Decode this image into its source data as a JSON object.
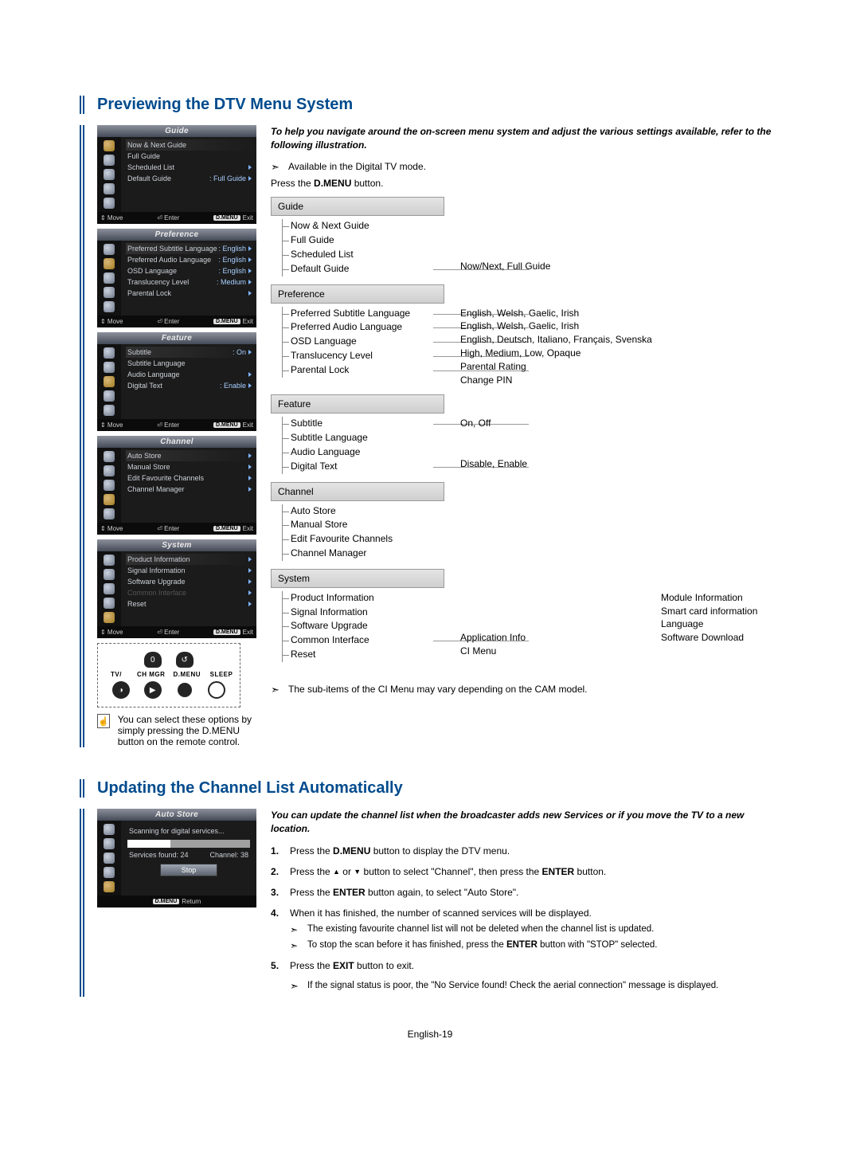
{
  "page_footer": "English-19",
  "section1": {
    "title": "Previewing the DTV Menu System",
    "intro": "To help you navigate around the on-screen menu system and adjust the various settings available, refer to the following illustration.",
    "note_digital": "Available in the Digital TV mode.",
    "press_line_a": "Press the ",
    "press_line_b": "D.MENU",
    "press_line_c": " button.",
    "ci_note": "The sub-items of the CI Menu may vary depending on the CAM model.",
    "tip": "You can select these options by simply pressing the D.MENU button on the remote control.",
    "remote_labels": [
      "TV/",
      "CH MGR",
      "D.MENU",
      "SLEEP"
    ],
    "foot": {
      "move": "Move",
      "enter": "Enter",
      "dmenu": "D.MENU",
      "exit": "Exit",
      "return": "Return"
    },
    "panels": [
      {
        "title": "Guide",
        "rows": [
          {
            "l": "Now & Next Guide",
            "r": "",
            "arrow": false,
            "hl": true
          },
          {
            "l": "Full Guide",
            "r": "",
            "arrow": false
          },
          {
            "l": "Scheduled List",
            "r": "",
            "arrow": true
          },
          {
            "l": "Default Guide",
            "r": ": Full Guide",
            "arrow": true
          }
        ]
      },
      {
        "title": "Preference",
        "rows": [
          {
            "l": "Preferred Subtitle Language",
            "r": ": English",
            "arrow": true,
            "hl": true
          },
          {
            "l": "Preferred Audio Language",
            "r": ": English",
            "arrow": true
          },
          {
            "l": "OSD Language",
            "r": ": English",
            "arrow": true
          },
          {
            "l": "Translucency Level",
            "r": ": Medium",
            "arrow": true
          },
          {
            "l": "Parental Lock",
            "r": "",
            "arrow": true
          }
        ]
      },
      {
        "title": "Feature",
        "rows": [
          {
            "l": "Subtitle",
            "r": ": On",
            "arrow": true,
            "hl": true
          },
          {
            "l": "Subtitle Language",
            "r": "",
            "arrow": false
          },
          {
            "l": "Audio Language",
            "r": "",
            "arrow": true
          },
          {
            "l": "Digital Text",
            "r": ": Enable",
            "arrow": true
          }
        ]
      },
      {
        "title": "Channel",
        "rows": [
          {
            "l": "Auto Store",
            "r": "",
            "arrow": true,
            "hl": true
          },
          {
            "l": "Manual Store",
            "r": "",
            "arrow": true
          },
          {
            "l": "Edit Favourite Channels",
            "r": "",
            "arrow": true
          },
          {
            "l": "Channel Manager",
            "r": "",
            "arrow": true
          }
        ]
      },
      {
        "title": "System",
        "rows": [
          {
            "l": "Product Information",
            "r": "",
            "arrow": true,
            "hl": true
          },
          {
            "l": "Signal Information",
            "r": "",
            "arrow": true
          },
          {
            "l": "Software Upgrade",
            "r": "",
            "arrow": true
          },
          {
            "l": "Common Interface",
            "r": "",
            "arrow": true,
            "dim": true
          },
          {
            "l": "Reset",
            "r": "",
            "arrow": true
          }
        ]
      }
    ],
    "tree": [
      {
        "head": "Guide",
        "items": [
          {
            "l": "Now & Next Guide",
            "link": false
          },
          {
            "l": "Full Guide",
            "link": false
          },
          {
            "l": "Scheduled List",
            "link": false
          },
          {
            "l": "Default Guide",
            "link": true
          }
        ],
        "vals": [
          "",
          "",
          "",
          "Now/Next, Full Guide"
        ]
      },
      {
        "head": "Preference",
        "items": [
          {
            "l": "Preferred Subtitle Language",
            "link": true
          },
          {
            "l": "Preferred Audio Language",
            "link": true
          },
          {
            "l": "OSD Language",
            "link": true
          },
          {
            "l": "Translucency Level",
            "link": true
          },
          {
            "l": "Parental Lock",
            "link": true
          }
        ],
        "vals": [
          "English, Welsh, Gaelic, Irish",
          "English, Welsh, Gaelic, Irish",
          "English, Deutsch, Italiano, Français, Svenska",
          "High, Medium, Low, Opaque",
          "Parental Rating<br>Change PIN"
        ]
      },
      {
        "head": "Feature",
        "items": [
          {
            "l": "Subtitle",
            "link": true
          },
          {
            "l": "Subtitle Language",
            "link": false
          },
          {
            "l": "Audio Language",
            "link": false
          },
          {
            "l": "Digital Text",
            "link": true
          }
        ],
        "vals": [
          "On, Off",
          "",
          "",
          "Disable, Enable"
        ]
      },
      {
        "head": "Channel",
        "items": [
          {
            "l": "Auto Store",
            "link": false
          },
          {
            "l": "Manual Store",
            "link": false
          },
          {
            "l": "Edit Favourite Channels",
            "link": false
          },
          {
            "l": "Channel Manager",
            "link": false
          }
        ],
        "vals": []
      },
      {
        "head": "System",
        "items": [
          {
            "l": "Product Information",
            "link": false
          },
          {
            "l": "Signal Information",
            "link": false
          },
          {
            "l": "Software Upgrade",
            "link": false
          },
          {
            "l": "Common Interface",
            "link": true
          },
          {
            "l": "Reset",
            "link": false
          }
        ],
        "vals": [
          "",
          "",
          "",
          "Application Info<br>CI Menu",
          ""
        ],
        "extra": [
          "Module Information",
          "Smart card information",
          "Language",
          "Software Download"
        ]
      }
    ]
  },
  "section2": {
    "title": "Updating the Channel List Automatically",
    "intro": "You can update the channel list when the broadcaster adds new Services or if you move the TV to a new location.",
    "panel": {
      "title": "Auto Store",
      "scanning": "Scanning for digital services...",
      "percent": "35%",
      "services_label": "Services found: 24",
      "channel_label": "Channel: 38",
      "stop": "Stop"
    },
    "steps": [
      {
        "pre": "Press the ",
        "b": "D.MENU",
        "post": " button to display the DTV menu."
      },
      {
        "pre": "Press the ",
        "mid": " or ",
        "post": " button to select \"Channel\", then press the ",
        "b": "ENTER",
        "tail": " button."
      },
      {
        "pre": "Press the ",
        "b": "ENTER",
        "post": " button again, to select \"Auto Store\"."
      },
      {
        "pre": "When it has finished, the number of scanned services will be displayed.",
        "subs": [
          "The existing favourite channel list will not be deleted when the channel list is updated.",
          "To stop the scan before it has finished, press the ENTER button with \"STOP\" selected."
        ]
      },
      {
        "pre": "Press the ",
        "b": "EXIT",
        "post": " button to exit."
      }
    ],
    "poor_signal": "If the signal status is poor, the \"No Service found! Check the aerial connection\" message is displayed."
  }
}
